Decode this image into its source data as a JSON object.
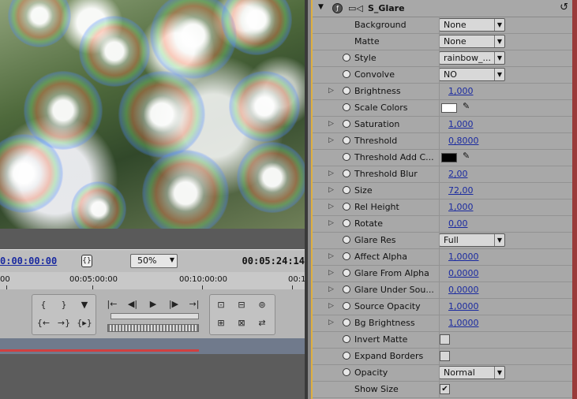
{
  "monitor": {
    "current_timecode": "0:00:00:00",
    "zoom": "50%",
    "duration_timecode": "00:05:24:14",
    "ruler_labels": [
      "00",
      "00:05:00:00",
      "00:10:00:00",
      "00:1"
    ]
  },
  "effect": {
    "name": "S_Glare",
    "params": [
      {
        "label": "Background",
        "type": "dropdown",
        "value": "None",
        "twirl": false,
        "stopwatch": false
      },
      {
        "label": "Matte",
        "type": "dropdown",
        "value": "None",
        "twirl": false,
        "stopwatch": false
      },
      {
        "label": "Style",
        "type": "dropdown",
        "value": "rainbow_...",
        "twirl": false,
        "stopwatch": true
      },
      {
        "label": "Convolve",
        "type": "dropdown",
        "value": "NO",
        "twirl": false,
        "stopwatch": true
      },
      {
        "label": "Brightness",
        "type": "number",
        "value": "1,000",
        "twirl": true,
        "stopwatch": true
      },
      {
        "label": "Scale Colors",
        "type": "color",
        "value": "#ffffff",
        "twirl": false,
        "stopwatch": true
      },
      {
        "label": "Saturation",
        "type": "number",
        "value": "1,000",
        "twirl": true,
        "stopwatch": true
      },
      {
        "label": "Threshold",
        "type": "number",
        "value": "0,8000",
        "twirl": true,
        "stopwatch": true
      },
      {
        "label": "Threshold Add C...",
        "type": "color",
        "value": "#000000",
        "twirl": false,
        "stopwatch": true
      },
      {
        "label": "Threshold Blur",
        "type": "number",
        "value": "2,00",
        "twirl": true,
        "stopwatch": true
      },
      {
        "label": "Size",
        "type": "number",
        "value": "72,00",
        "twirl": true,
        "stopwatch": true
      },
      {
        "label": "Rel Height",
        "type": "number",
        "value": "1,000",
        "twirl": true,
        "stopwatch": true
      },
      {
        "label": "Rotate",
        "type": "number",
        "value": "0,00",
        "twirl": true,
        "stopwatch": true
      },
      {
        "label": "Glare Res",
        "type": "dropdown",
        "value": "Full",
        "twirl": false,
        "stopwatch": true
      },
      {
        "label": "Affect Alpha",
        "type": "number",
        "value": "1,0000",
        "twirl": true,
        "stopwatch": true
      },
      {
        "label": "Glare From Alpha",
        "type": "number",
        "value": "0,0000",
        "twirl": true,
        "stopwatch": true
      },
      {
        "label": "Glare Under Sou...",
        "type": "number",
        "value": "0,0000",
        "twirl": true,
        "stopwatch": true
      },
      {
        "label": "Source Opacity",
        "type": "number",
        "value": "1,0000",
        "twirl": true,
        "stopwatch": true
      },
      {
        "label": "Bg Brightness",
        "type": "number",
        "value": "1,0000",
        "twirl": true,
        "stopwatch": true
      },
      {
        "label": "Invert Matte",
        "type": "checkbox",
        "value": false,
        "twirl": false,
        "stopwatch": true
      },
      {
        "label": "Expand Borders",
        "type": "checkbox",
        "value": false,
        "twirl": false,
        "stopwatch": true
      },
      {
        "label": "Opacity",
        "type": "dropdown",
        "value": "Normal",
        "twirl": false,
        "stopwatch": true
      },
      {
        "label": "Show Size",
        "type": "checkbox",
        "value": true,
        "twirl": false,
        "stopwatch": false
      }
    ]
  }
}
